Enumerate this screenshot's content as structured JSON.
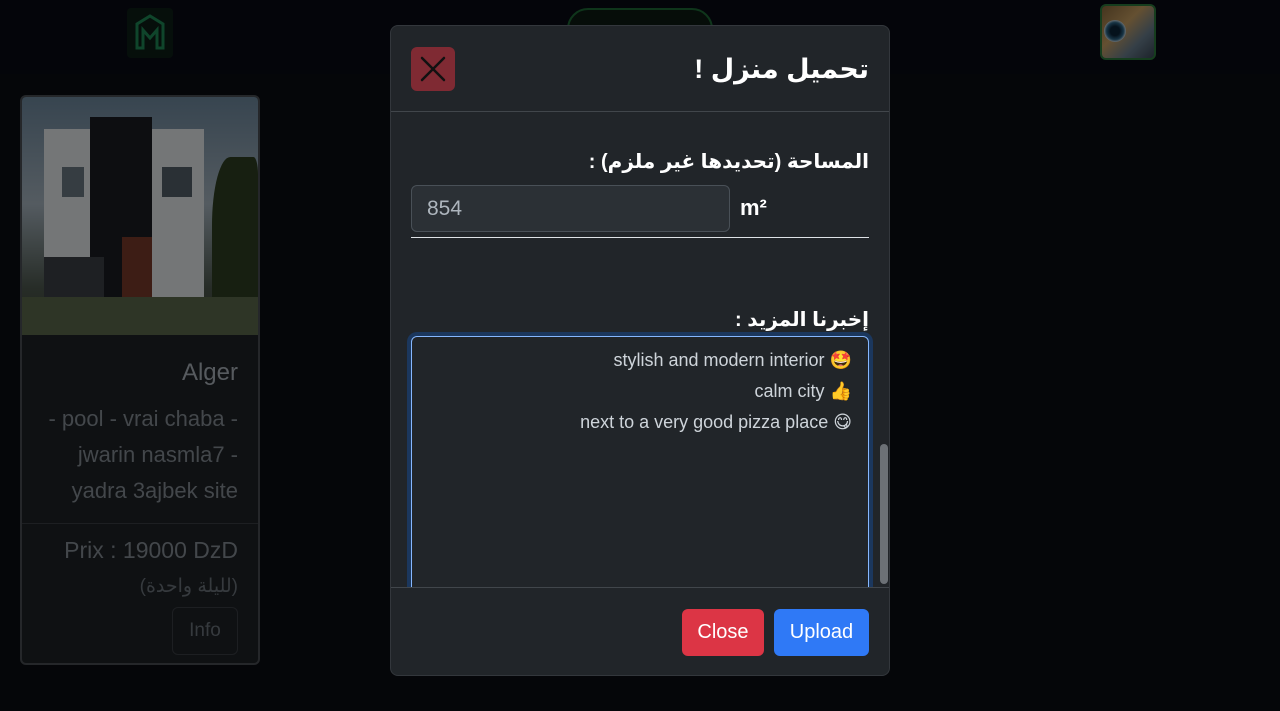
{
  "navbar": {
    "logo_icon": "house-logo-icon",
    "avatar_icon": "user-avatar"
  },
  "card": {
    "city": "Alger",
    "description": "- pool - vrai chaba - jwarin nasmla7 - yadra 3ajbek site",
    "price": "Prix : 19000 DzD",
    "per_night": "(لليلة واحدة)",
    "info_label": "Info"
  },
  "modal": {
    "title": "تحميل منزل !",
    "close_icon": "close-x-icon",
    "area_label": "المساحة (تحديدها غير ملزم) :",
    "area_value": "854",
    "area_unit": "m²",
    "more_label": "إخبرنا المزيد :",
    "details_lines": [
      "stylish and modern interior",
      "calm city",
      "next to a very good pizza place"
    ],
    "details_emojis": [
      "🤩",
      "👍",
      "😋"
    ],
    "close_label": "Close",
    "upload_label": "Upload"
  },
  "colors": {
    "close_button": "#dc3545",
    "upload_button": "#2f79f6",
    "modal_bg": "#212529",
    "focus_border": "#86b7fe"
  }
}
